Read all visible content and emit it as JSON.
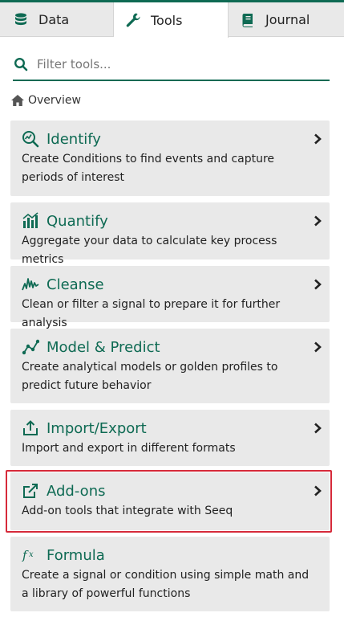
{
  "tabs": {
    "data": {
      "label": "Data",
      "icon": "database-icon"
    },
    "tools": {
      "label": "Tools",
      "icon": "wrench-icon"
    },
    "journal": {
      "label": "Journal",
      "icon": "book-icon"
    }
  },
  "search": {
    "placeholder": "Filter tools...",
    "value": ""
  },
  "breadcrumb": {
    "label": "Overview",
    "icon": "home-icon"
  },
  "tools": [
    {
      "title": "Identify",
      "description": "Create Conditions to find events and capture periods of interest",
      "icon": "identify-icon"
    },
    {
      "title": "Quantify",
      "description": "Aggregate your data to calculate key process metrics",
      "icon": "bar-chart-icon"
    },
    {
      "title": "Cleanse",
      "description": "Clean or filter a signal to prepare it for further analysis",
      "icon": "signal-icon"
    },
    {
      "title": "Model & Predict",
      "description": "Create analytical models or golden profiles to predict future behavior",
      "icon": "model-icon"
    },
    {
      "title": "Import/Export",
      "description": "Import and export in different formats",
      "icon": "upload-icon"
    },
    {
      "title": "Add-ons",
      "description": "Add-on tools that integrate with Seeq",
      "icon": "external-link-icon"
    },
    {
      "title": "Formula",
      "description": "Create a signal or condition using simple math and a library of powerful functions",
      "icon": "fx-icon"
    }
  ],
  "colors": {
    "accent": "#0e6a53",
    "highlight": "#d62a3a",
    "card_bg": "#e9e9e9"
  }
}
